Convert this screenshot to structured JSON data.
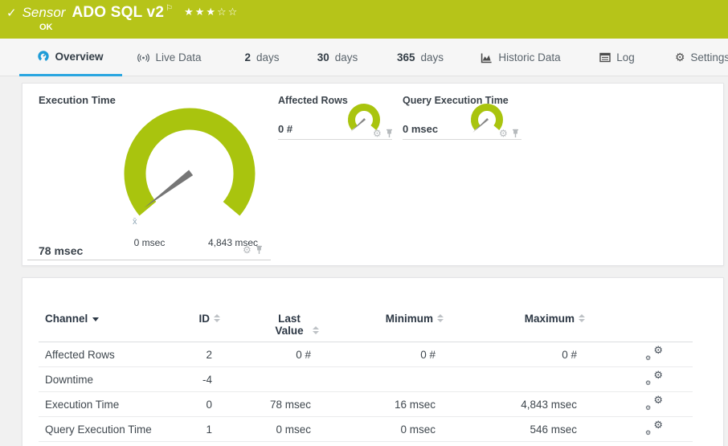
{
  "header": {
    "status_icon": "✓",
    "kind": "Sensor",
    "title": "ADO SQL v2",
    "flag_icon": "⚐",
    "stars_filled": "★★★",
    "stars_empty": "☆☆",
    "status": "OK"
  },
  "tabs": [
    {
      "label": "Overview",
      "active": true
    },
    {
      "label": "Live Data"
    },
    {
      "num": "2",
      "label": "days"
    },
    {
      "num": "30",
      "label": "days"
    },
    {
      "num": "365",
      "label": "days"
    },
    {
      "label": "Historic Data"
    },
    {
      "label": "Log"
    },
    {
      "label": "Settings"
    }
  ],
  "gauges": {
    "main": {
      "title": "Execution Time",
      "value": "78 msec",
      "min": "0 msec",
      "max": "4,843 msec",
      "avg_marker": "x̄",
      "needle_deg": 233
    },
    "small": [
      {
        "title": "Affected Rows",
        "value": "0 #",
        "needle_deg": 228
      },
      {
        "title": "Query Execution Time",
        "value": "0 msec",
        "needle_deg": 228
      }
    ]
  },
  "table": {
    "headers": [
      "Channel",
      "ID",
      "Last Value",
      "Minimum",
      "Maximum"
    ],
    "rows": [
      {
        "channel": "Affected Rows",
        "id": "2",
        "last": "0 #",
        "min": "0 #",
        "max": "0 #"
      },
      {
        "channel": "Downtime",
        "id": "-4",
        "last": "",
        "min": "",
        "max": ""
      },
      {
        "channel": "Execution Time",
        "id": "0",
        "last": "78 msec",
        "min": "16 msec",
        "max": "4,843 msec"
      },
      {
        "channel": "Query Execution Time",
        "id": "1",
        "last": "0 msec",
        "min": "0 msec",
        "max": "546 msec"
      }
    ]
  },
  "icons": {
    "gear": "⚙"
  },
  "colors": {
    "status_green": "#b6c419",
    "gauge_green": "#a9c40e",
    "accent_blue": "#2aa6e0"
  }
}
